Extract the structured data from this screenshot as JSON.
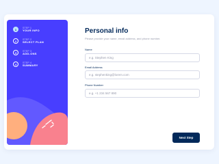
{
  "steps": [
    {
      "number": "1",
      "kicker": "STEP 1",
      "title": "YOUR INFO"
    },
    {
      "number": "2",
      "kicker": "STEP 2",
      "title": "SELECT PLAN"
    },
    {
      "number": "3",
      "kicker": "STEP 3",
      "title": "ADD-ONS"
    },
    {
      "number": "4",
      "kicker": "STEP 4",
      "title": "SUMMARY"
    }
  ],
  "form": {
    "title": "Personal info",
    "subtitle": "Please provide your name, email address, and phone number.",
    "name_label": "Name",
    "name_placeholder": "e.g. Stephen King",
    "email_label": "Email Address",
    "email_placeholder": "e.g. stephenking@lorem.com",
    "phone_label": "Phone Number",
    "phone_placeholder": "e.g. +1 234 567 890"
  },
  "actions": {
    "next_label": "Next Step"
  },
  "colors": {
    "sidebar_bg": "#483eff",
    "active_step": "#bee2fd",
    "primary_dark": "#02295a",
    "muted_text": "#9699ab",
    "border": "#d6d9e6"
  }
}
